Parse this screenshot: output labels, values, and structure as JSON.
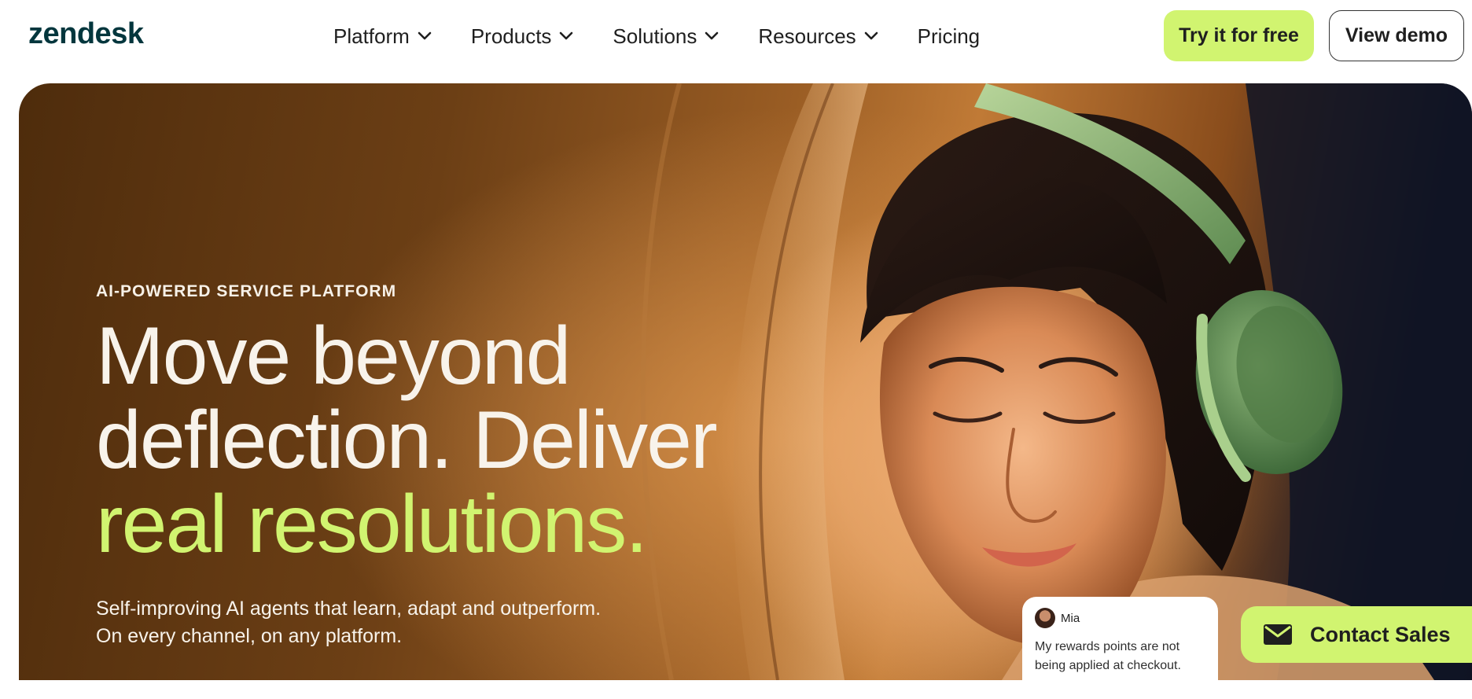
{
  "header": {
    "logo": "zendesk",
    "nav": [
      {
        "label": "Platform",
        "has_menu": true
      },
      {
        "label": "Products",
        "has_menu": true
      },
      {
        "label": "Solutions",
        "has_menu": true
      },
      {
        "label": "Resources",
        "has_menu": true
      },
      {
        "label": "Pricing",
        "has_menu": false
      }
    ],
    "cta_primary": "Try it for free",
    "cta_secondary": "View demo"
  },
  "hero": {
    "eyebrow": "AI-POWERED SERVICE PLATFORM",
    "headline_lines": [
      "Move beyond",
      "deflection. Deliver"
    ],
    "headline_accent": "real resolutions.",
    "subcopy_lines": [
      "Self-improving AI agents that learn, adapt and outperform.",
      "On every channel, on any platform."
    ]
  },
  "chat": {
    "name": "Mia",
    "message_lines": [
      "My rewards points are not",
      "being applied at checkout."
    ]
  },
  "contact": {
    "label": "Contact Sales",
    "icon": "mail-icon"
  },
  "colors": {
    "accent": "#d1f470",
    "headline_text": "#f8f3eb",
    "logo": "#03363d"
  }
}
